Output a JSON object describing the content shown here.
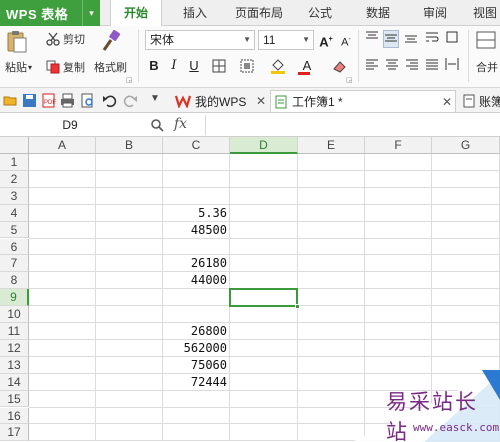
{
  "app": {
    "logo": "WPS 表格"
  },
  "ribbon_tabs": [
    {
      "label": "开始",
      "active": true
    },
    {
      "label": "插入"
    },
    {
      "label": "页面布局"
    },
    {
      "label": "公式"
    },
    {
      "label": "数据"
    },
    {
      "label": "审阅"
    },
    {
      "label": "视图"
    }
  ],
  "ribbon": {
    "paste_label": "粘贴",
    "cut_label": "剪切",
    "copy_label": "复制",
    "format_painter_label": "格式刷",
    "font_name": "宋体",
    "font_size": "11",
    "grow_font": "A",
    "shrink_font": "A",
    "bold": "B",
    "italic": "I",
    "underline": "U",
    "font_color_glyph": "A",
    "merge_label": "合并"
  },
  "doc_tabs": [
    {
      "label": "我的WPS",
      "closable": true
    },
    {
      "label": "工作簿1 *",
      "closable": true,
      "active": true
    },
    {
      "label": "账簿"
    }
  ],
  "formula_bar": {
    "name_box": "D9",
    "fx_label": "fx",
    "value": ""
  },
  "grid": {
    "columns": [
      "A",
      "B",
      "C",
      "D",
      "E",
      "F",
      "G"
    ],
    "selected_column": "D",
    "rows": [
      "1",
      "2",
      "3",
      "4",
      "5",
      "6",
      "7",
      "8",
      "9",
      "10",
      "11",
      "12",
      "13",
      "14",
      "15",
      "16",
      "17"
    ],
    "selected_row": "9",
    "active_cell": "D9",
    "cells": [
      {
        "ref": "C4",
        "value": "5.36"
      },
      {
        "ref": "C5",
        "value": "48500"
      },
      {
        "ref": "C7",
        "value": "26180"
      },
      {
        "ref": "C8",
        "value": "44000"
      },
      {
        "ref": "C11",
        "value": "26800"
      },
      {
        "ref": "C12",
        "value": "562000"
      },
      {
        "ref": "C13",
        "value": "75060"
      },
      {
        "ref": "C14",
        "value": "72444"
      }
    ]
  },
  "watermark": {
    "text": "易采站长站",
    "url": "www.easck.com"
  },
  "colors": {
    "accent_green": "#3c9a3c",
    "watermark_purple": "#7a2a86"
  }
}
